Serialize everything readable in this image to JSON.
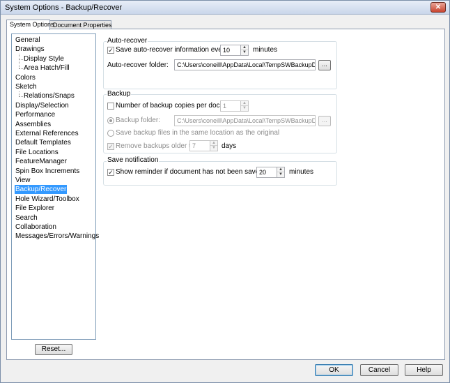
{
  "window": {
    "title": "System Options - Backup/Recover",
    "close_glyph": "✕"
  },
  "tabs": [
    {
      "label": "System Options",
      "active": true
    },
    {
      "label": "Document Properties",
      "active": false
    }
  ],
  "tree": [
    {
      "label": "General",
      "level": 0,
      "selected": false
    },
    {
      "label": "Drawings",
      "level": 0,
      "selected": false
    },
    {
      "label": "Display Style",
      "level": 1,
      "selected": false
    },
    {
      "label": "Area Hatch/Fill",
      "level": 1,
      "selected": false
    },
    {
      "label": "Colors",
      "level": 0,
      "selected": false
    },
    {
      "label": "Sketch",
      "level": 0,
      "selected": false
    },
    {
      "label": "Relations/Snaps",
      "level": 1,
      "selected": false
    },
    {
      "label": "Display/Selection",
      "level": 0,
      "selected": false
    },
    {
      "label": "Performance",
      "level": 0,
      "selected": false
    },
    {
      "label": "Assemblies",
      "level": 0,
      "selected": false
    },
    {
      "label": "External References",
      "level": 0,
      "selected": false
    },
    {
      "label": "Default Templates",
      "level": 0,
      "selected": false
    },
    {
      "label": "File Locations",
      "level": 0,
      "selected": false
    },
    {
      "label": "FeatureManager",
      "level": 0,
      "selected": false
    },
    {
      "label": "Spin Box Increments",
      "level": 0,
      "selected": false
    },
    {
      "label": "View",
      "level": 0,
      "selected": false
    },
    {
      "label": "Backup/Recover",
      "level": 0,
      "selected": true
    },
    {
      "label": "Hole Wizard/Toolbox",
      "level": 0,
      "selected": false
    },
    {
      "label": "File Explorer",
      "level": 0,
      "selected": false
    },
    {
      "label": "Search",
      "level": 0,
      "selected": false
    },
    {
      "label": "Collaboration",
      "level": 0,
      "selected": false
    },
    {
      "label": "Messages/Errors/Warnings",
      "level": 0,
      "selected": false
    }
  ],
  "reset_label": "Reset...",
  "auto_recover": {
    "group_label": "Auto-recover",
    "save_checkbox_label": "Save auto-recover information every",
    "save_checked": true,
    "interval_value": "10",
    "interval_unit": "minutes",
    "folder_label": "Auto-recover folder:",
    "folder_value": "C:\\Users\\coneill\\AppData\\Local\\TempSWBackupDirectory",
    "browse_label": "..."
  },
  "backup": {
    "group_label": "Backup",
    "copies_label": "Number of backup copies per document:",
    "copies_checked": false,
    "copies_value": "1",
    "folder_radio_label": "Backup folder:",
    "folder_value": "C:\\Users\\coneill\\AppData\\Local\\TempSWBackupDirectory",
    "browse_label": "...",
    "same_location_label": "Save backup files in the same location as the original",
    "remove_label": "Remove backups older than",
    "remove_checked": true,
    "remove_value": "7",
    "remove_unit": "days"
  },
  "save_notification": {
    "group_label": "Save notification",
    "reminder_label": "Show reminder if document has not been saved for:",
    "reminder_checked": true,
    "reminder_value": "20",
    "reminder_unit": "minutes"
  },
  "buttons": {
    "ok": "OK",
    "cancel": "Cancel",
    "help": "Help"
  }
}
